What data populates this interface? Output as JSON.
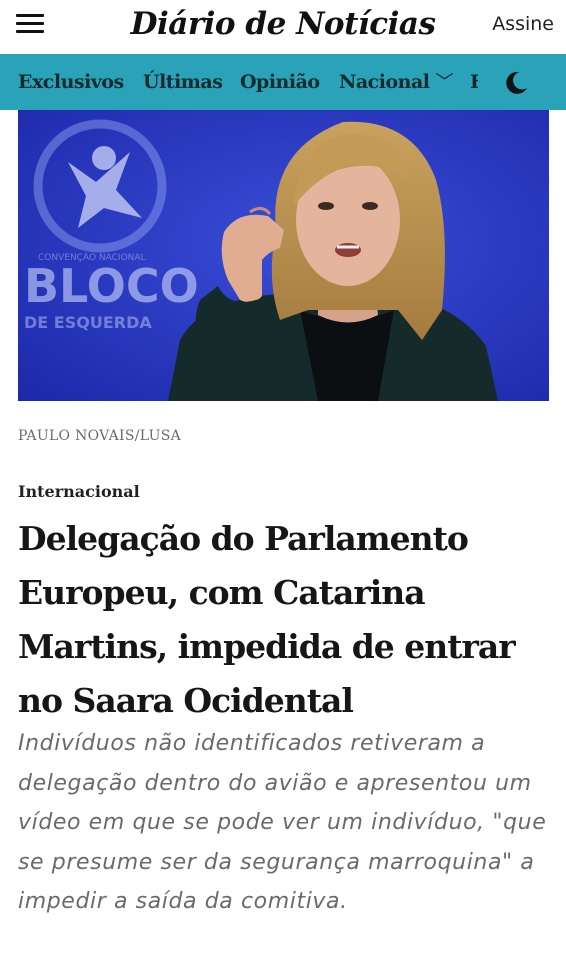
{
  "header": {
    "masthead": "Diário de Notícias",
    "subscribe_label": "Assine"
  },
  "nav": {
    "items": [
      {
        "label": "Exclusivos"
      },
      {
        "label": "Últimas"
      },
      {
        "label": "Opinião"
      },
      {
        "label": "Nacional"
      },
      {
        "label": "E"
      }
    ],
    "color": "#2aa3b9"
  },
  "photo": {
    "sign_text": [
      "BLOCO",
      "DE ESQUERDA"
    ]
  },
  "article": {
    "photo_credit": "PAULO NOVAIS/LUSA",
    "section": "Internacional",
    "headline": "Delegação do Parlamento Europeu, com Catarina Martins, impedida de entrar no Saara Ocidental",
    "lead": "Indivíduos não identificados retiveram a delegação dentro do avião e apresentou um vídeo em que se pode ver um indivíduo, \"que se presume ser da segurança marroquina\" a impedir a saída da comitiva."
  }
}
